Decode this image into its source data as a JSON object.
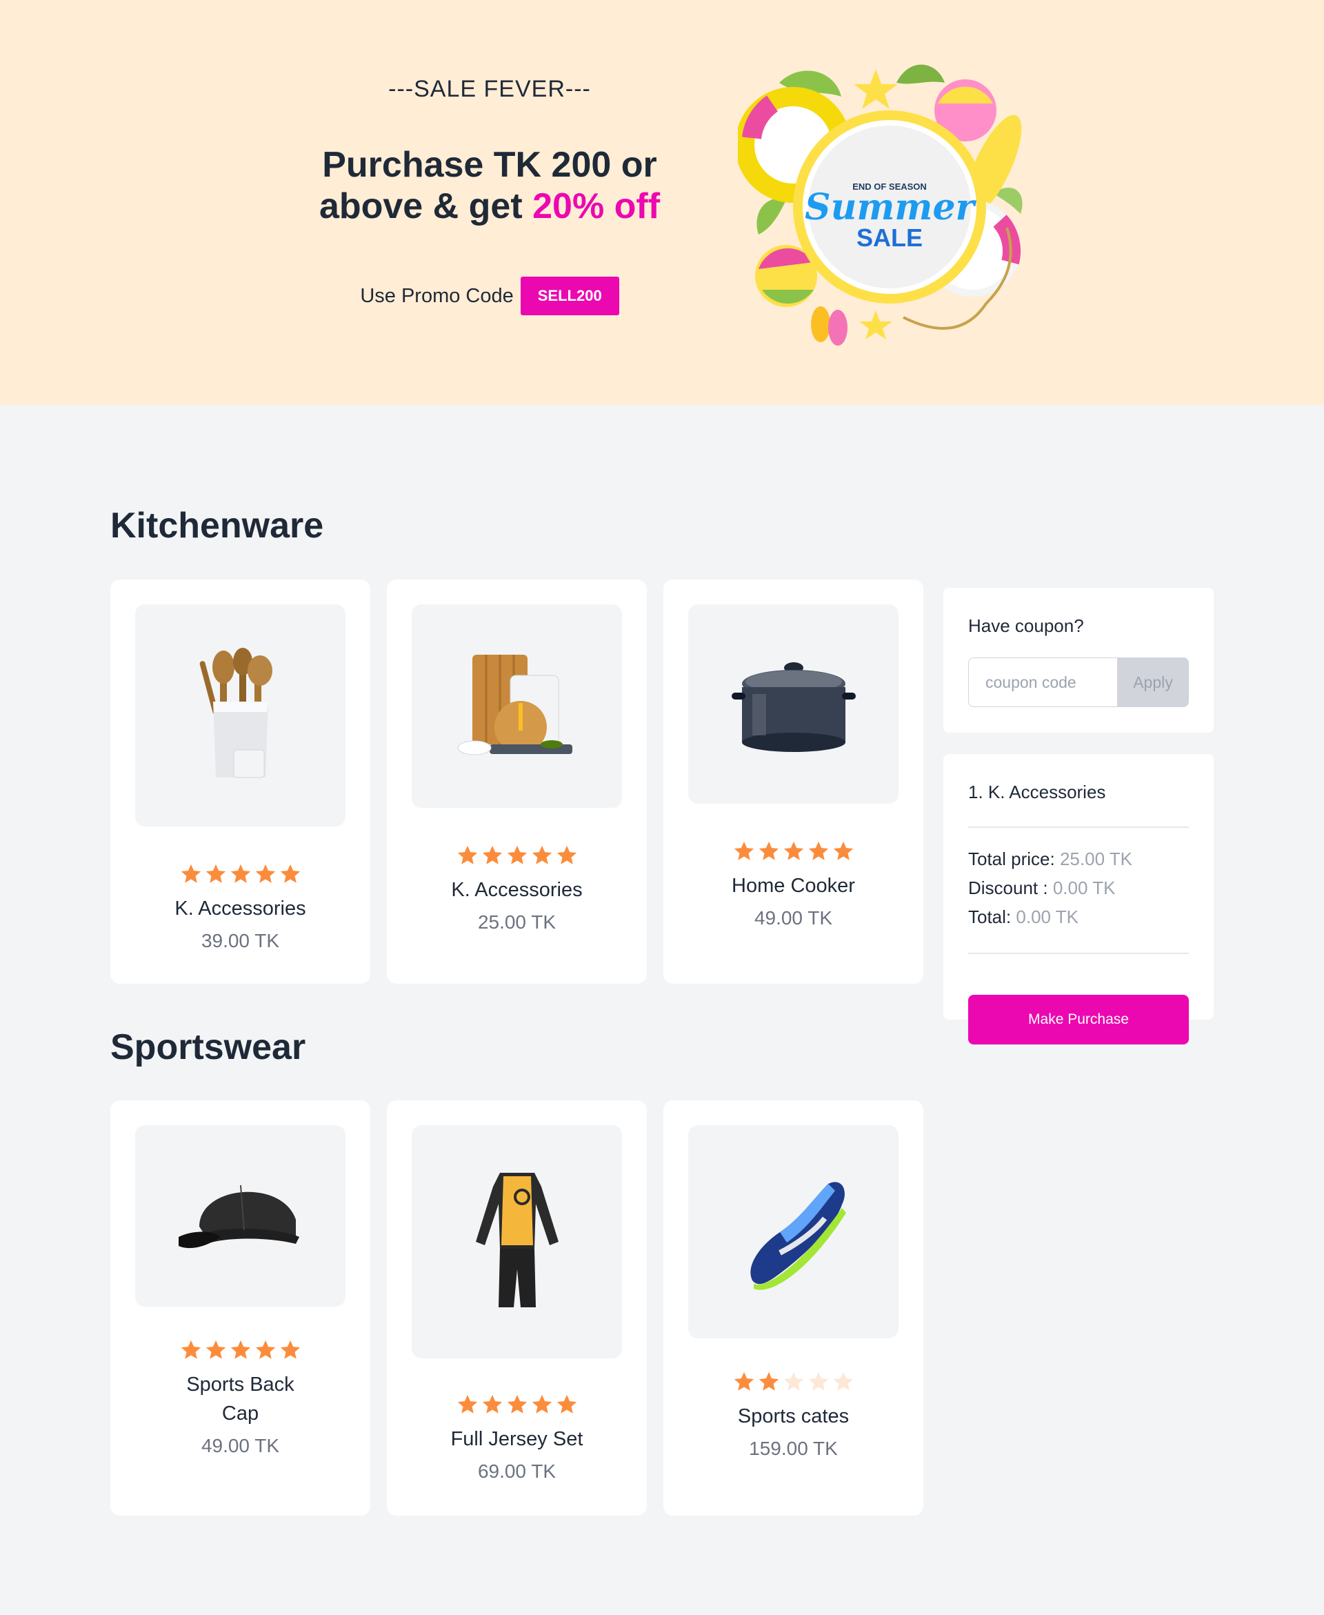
{
  "hero": {
    "kicker": "---SALE FEVER---",
    "title_line1": "Purchase TK 200 or",
    "title_line2_prefix": "above & get ",
    "title_accent": "20% off",
    "promo_label": "Use Promo Code",
    "promo_code": "SELL200",
    "badge_top": "END OF SEASON",
    "badge_script": "Summer",
    "badge_bottom": "SALE"
  },
  "sections": {
    "kitchenware": {
      "title": "Kitchenware",
      "products": [
        {
          "name": "K. Accessories",
          "price": "39.00 TK",
          "rating": 5,
          "image": "utensil-holder-image"
        },
        {
          "name": "K. Accessories",
          "price": "25.00 TK",
          "rating": 5,
          "image": "cutting-boards-image"
        },
        {
          "name": "Home Cooker",
          "price": "49.00 TK",
          "rating": 5,
          "image": "cooking-pot-image"
        }
      ]
    },
    "sportswear": {
      "title": "Sportswear",
      "products": [
        {
          "name": "Sports Back Cap",
          "price": "49.00 TK",
          "rating": 5,
          "image": "cap-image"
        },
        {
          "name": "Full Jersey Set",
          "price": "69.00 TK",
          "rating": 5,
          "image": "jersey-image"
        },
        {
          "name": "Sports cates",
          "price": "159.00 TK",
          "rating": 2,
          "image": "sneaker-image"
        }
      ]
    }
  },
  "coupon": {
    "label": "Have coupon?",
    "placeholder": "coupon code",
    "apply_label": "Apply"
  },
  "cart": {
    "items": [
      "1. K. Accessories"
    ],
    "total_price_label": "Total price:",
    "total_price_value": "25.00 TK",
    "discount_label": "Discount :",
    "discount_value": "0.00 TK",
    "total_label": "Total:",
    "total_value": "0.00 TK",
    "purchase_label": "Make Purchase"
  },
  "colors": {
    "accent": "#ec08b0",
    "star": "#fb8c3c",
    "star_empty": "#fde7d6",
    "hero_bg": "#ffedd5"
  }
}
